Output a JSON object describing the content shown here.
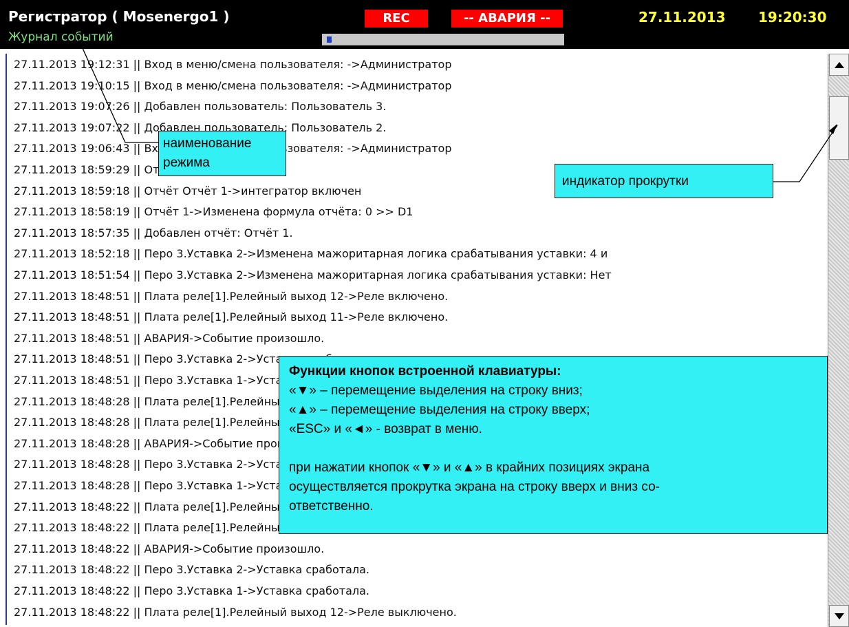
{
  "header": {
    "title": "Регистратор ( Mosenergo1 )",
    "mode_name": "Журнал событий",
    "rec_label": "REC",
    "alarm_label": "-- АВАРИЯ --",
    "date": "27.11.2013",
    "time": "19:20:30",
    "progress_fraction": 0.02
  },
  "log": {
    "rows": [
      "27.11.2013  19:12:31 || Вход в меню/смена пользователя: ->Администратор",
      "27.11.2013  19:10:15 || Вход в меню/смена пользователя: ->Администратор",
      "27.11.2013  19:07:26 || Добавлен пользователь: Пользователь 3.",
      "27.11.2013  19:07:22 || Добавлен пользователь: Пользователь 2.",
      "27.11.2013  19:06:43 || Вход в меню/смена пользователя: ->Администратор",
      "27.11.2013  18:59:29 || Отчёт Отчёт 1 включен",
      "27.11.2013  18:59:18 || Отчёт Отчёт 1->интегратор включен",
      "27.11.2013  18:58:19 || Отчёт 1->Изменена формула отчёта: 0 >> D1",
      "27.11.2013  18:57:35 || Добавлен отчёт: Отчёт 1.",
      "27.11.2013  18:52:18 || Перо 3.Уставка 2->Изменена мажоритарная логика срабатывания уставки: 4 и",
      "27.11.2013  18:51:54 || Перо 3.Уставка 2->Изменена мажоритарная логика срабатывания уставки: Нет",
      "27.11.2013  18:48:51 || Плата реле[1].Релейный выход 12->Реле включено.",
      "27.11.2013  18:48:51 || Плата реле[1].Релейный выход 11->Реле включено.",
      "27.11.2013  18:48:51 || АВАРИЯ->Событие произошло.",
      "27.11.2013  18:48:51 || Перо 3.Уставка 2->Уставка сработала.",
      "27.11.2013  18:48:51 || Перо 3.Уставка 1->Уставка сработала.",
      "27.11.2013  18:48:28 || Плата реле[1].Релейный выход 12->Реле выключено.",
      "27.11.2013  18:48:28 || Плата реле[1].Релейный выход 11->Реле выключено.",
      "27.11.2013  18:48:28 || АВАРИЯ->Событие прошло.",
      "27.11.2013  18:48:28 || Перо 3.Уставка 2->Уставка не сработала.",
      "27.11.2013  18:48:28 || Перо 3.Уставка 1->Уставка не сработала.",
      "27.11.2013  18:48:22 || Плата реле[1].Релейный выход 12->Реле включено.",
      "27.11.2013  18:48:22 || Плата реле[1].Релейный выход 9->Реле включено.",
      "27.11.2013  18:48:22 || АВАРИЯ->Событие произошло.",
      "27.11.2013  18:48:22 || Перо 3.Уставка 2->Уставка сработала.",
      "27.11.2013  18:48:22 || Перо 3.Уставка 1->Уставка сработала.",
      "27.11.2013  18:48:22 || Плата реле[1].Релейный выход 12->Реле выключено."
    ]
  },
  "callouts": {
    "mode_name_line1": "наименование",
    "mode_name_line2": "режима",
    "scroll_indicator": "индикатор прокрутки",
    "keys_title": "Функции кнопок встроенной клавиатуры:",
    "keys_line1": "«▼» – перемещение выделения на строку вниз;",
    "keys_line2": "«▲» – перемещение выделения на строку вверх;",
    "keys_line3": "«ESC» и «◄» - возврат в меню.",
    "keys_note1": "при нажатии кнопок «▼» и «▲» в крайних позициях экрана",
    "keys_note2": "осуществляется прокрутка экрана на строку вверх и вниз со-",
    "keys_note3": "ответственно."
  },
  "colors": {
    "header_bg": "#000000",
    "title_color": "#ffffff",
    "mode_color": "#7ee27e",
    "alarm_red": "#ff0000",
    "clock_yellow": "#ffff33",
    "callout_cyan": "#33f0f5",
    "progress_blue": "#1f3fbf"
  }
}
